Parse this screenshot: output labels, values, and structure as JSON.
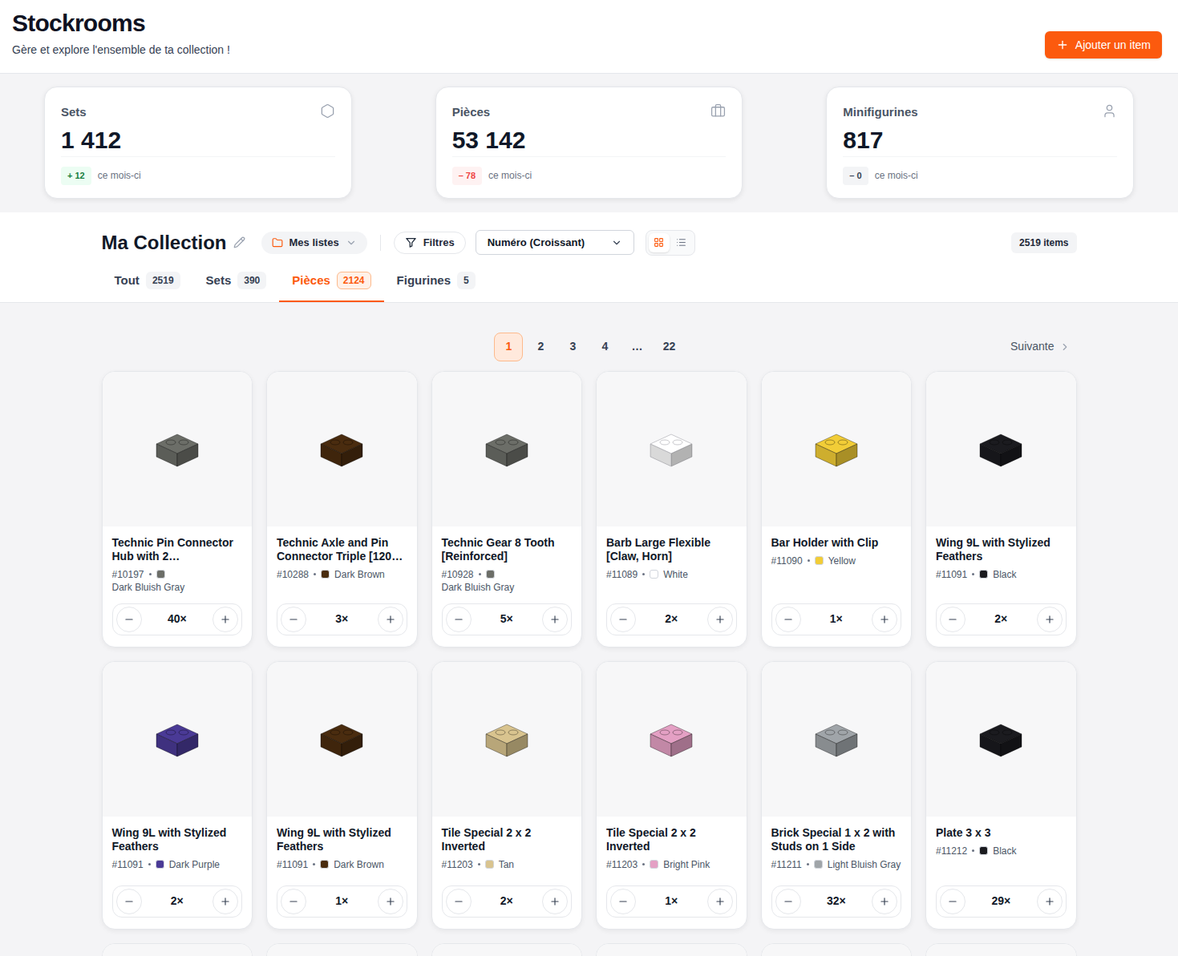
{
  "header": {
    "title": "Stockrooms",
    "subtitle": "Gère et explore l'ensemble de ta collection !",
    "add_button": "Ajouter un item"
  },
  "stats": [
    {
      "label": "Sets",
      "value": "1 412",
      "delta": "+ 12",
      "kind": "up",
      "suffix": "ce mois-ci"
    },
    {
      "label": "Pièces",
      "value": "53 142",
      "delta": "– 78",
      "kind": "down",
      "suffix": "ce mois-ci"
    },
    {
      "label": "Minifigurines",
      "value": "817",
      "delta": "– 0",
      "kind": "flat",
      "suffix": "ce mois-ci"
    }
  ],
  "toolbar": {
    "title": "Ma Collection",
    "lists_button": "Mes listes",
    "filters_button": "Filtres",
    "sort": "Numéro (Croissant)",
    "views": [
      {
        "kind": "grid",
        "selected": true
      },
      {
        "kind": "list",
        "selected": false
      }
    ],
    "count": "2519 items"
  },
  "tabs": [
    {
      "label": "Tout",
      "count": "2519",
      "selected": false
    },
    {
      "label": "Sets",
      "count": "390",
      "selected": false
    },
    {
      "label": "Pièces",
      "count": "2124",
      "selected": true
    },
    {
      "label": "Figurines",
      "count": "5",
      "selected": false
    }
  ],
  "pagination": {
    "pages": [
      {
        "label": "1",
        "selected": true
      },
      {
        "label": "2",
        "selected": false
      },
      {
        "label": "3",
        "selected": false
      },
      {
        "label": "4",
        "selected": false
      },
      {
        "label": "…",
        "selected": false
      },
      {
        "label": "22",
        "selected": false
      }
    ],
    "next": "Suivante"
  },
  "items": [
    {
      "name": "Technic Pin Connector Hub with 2…",
      "number": "#10197",
      "color_name": "Dark Bluish Gray",
      "color": "#6c6e68",
      "quantity": "40×"
    },
    {
      "name": "Technic Axle and Pin Connector Triple [120…",
      "number": "#10288",
      "color_name": "Dark Brown",
      "color": "#4a2c0f",
      "quantity": "3×"
    },
    {
      "name": "Technic Gear 8 Tooth [Reinforced]",
      "number": "#10928",
      "color_name": "Dark Bluish Gray",
      "color": "#6c6e68",
      "quantity": "5×"
    },
    {
      "name": "Barb Large Flexible [Claw, Horn]",
      "number": "#11089",
      "color_name": "White",
      "color": "#ffffff",
      "quantity": "2×"
    },
    {
      "name": "Bar Holder with Clip",
      "number": "#11090",
      "color_name": "Yellow",
      "color": "#f2cd37",
      "quantity": "1×"
    },
    {
      "name": "Wing 9L with Stylized Feathers",
      "number": "#11091",
      "color_name": "Black",
      "color": "#1b1b1f",
      "quantity": "2×"
    },
    {
      "name": "Wing 9L with Stylized Feathers",
      "number": "#11091",
      "color_name": "Dark Purple",
      "color": "#4a3a96",
      "quantity": "2×"
    },
    {
      "name": "Wing 9L with Stylized Feathers",
      "number": "#11091",
      "color_name": "Dark Brown",
      "color": "#4a2c0f",
      "quantity": "1×"
    },
    {
      "name": "Tile Special 2 x 2 Inverted",
      "number": "#11203",
      "color_name": "Tan",
      "color": "#d9c48f",
      "quantity": "2×"
    },
    {
      "name": "Tile Special 2 x 2 Inverted",
      "number": "#11203",
      "color_name": "Bright Pink",
      "color": "#e4a0c4",
      "quantity": "1×"
    },
    {
      "name": "Brick Special 1 x 2 with Studs on 1 Side",
      "number": "#11211",
      "color_name": "Light Bluish Gray",
      "color": "#a0a5a9",
      "quantity": "32×"
    },
    {
      "name": "Plate 3 x 3",
      "number": "#11212",
      "color_name": "Black",
      "color": "#1b1b1f",
      "quantity": "29×"
    }
  ]
}
